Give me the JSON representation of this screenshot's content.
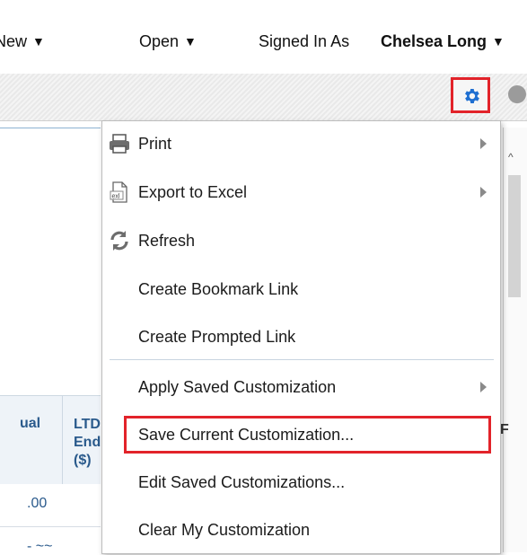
{
  "header": {
    "new_label": "New",
    "open_label": "Open",
    "signed_in_label": "Signed In As",
    "user_name": "Chelsea Long"
  },
  "background": {
    "col1_header": "ual",
    "col2_header_lines": [
      "LTD",
      "End",
      "($)"
    ],
    "value_1": ".00",
    "right_header": "F"
  },
  "menu": {
    "items": [
      {
        "label": "Print",
        "icon": "printer-icon",
        "submenu": true
      },
      {
        "label": "Export to Excel",
        "icon": "excel-icon",
        "submenu": true
      },
      {
        "label": "Refresh",
        "icon": "refresh-icon",
        "submenu": false
      },
      {
        "label": "Create Bookmark Link",
        "submenu": false
      },
      {
        "label": "Create Prompted Link",
        "submenu": false
      },
      {
        "label": "Apply Saved Customization",
        "submenu": true
      },
      {
        "label": "Save Current Customization...",
        "submenu": false,
        "highlighted": true
      },
      {
        "label": "Edit Saved Customizations...",
        "submenu": false
      },
      {
        "label": "Clear My Customization",
        "submenu": false
      }
    ]
  },
  "colors": {
    "highlight_red": "#e2232a",
    "gear_blue": "#1f6fd1",
    "link_blue": "#2a5a8c"
  }
}
